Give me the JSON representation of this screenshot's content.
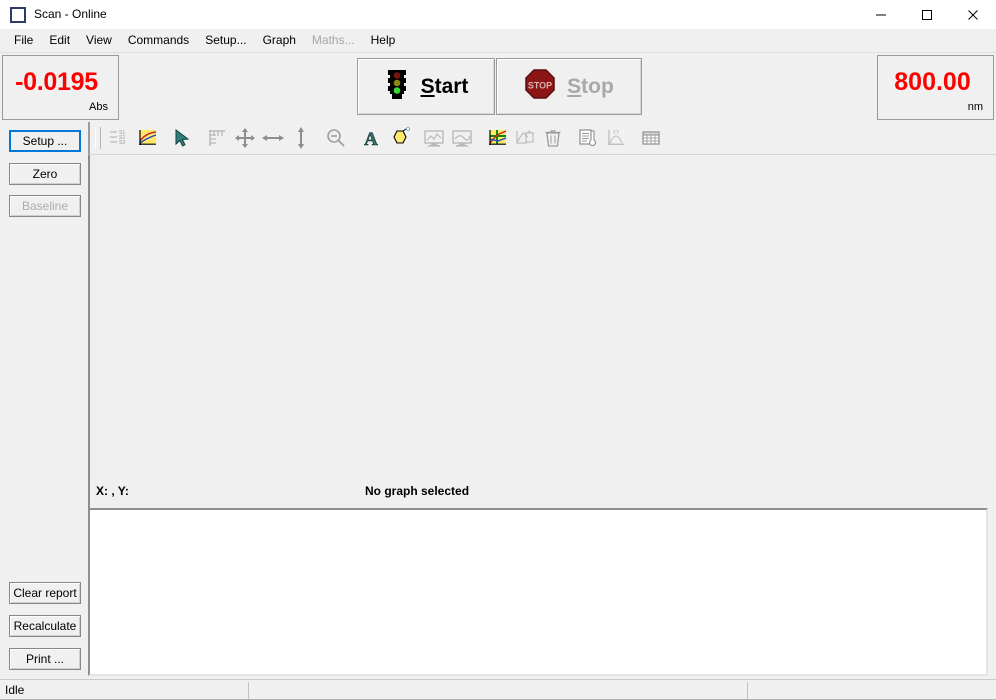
{
  "window": {
    "title": "Scan - Online",
    "icon": "app-window-icon",
    "controls": {
      "minimize": "minimize-icon",
      "maximize": "maximize-icon",
      "close": "close-icon"
    }
  },
  "menu": {
    "items": [
      {
        "label": "File",
        "enabled": true
      },
      {
        "label": "Edit",
        "enabled": true
      },
      {
        "label": "View",
        "enabled": true
      },
      {
        "label": "Commands",
        "enabled": true
      },
      {
        "label": "Setup...",
        "enabled": true
      },
      {
        "label": "Graph",
        "enabled": true
      },
      {
        "label": "Maths...",
        "enabled": false
      },
      {
        "label": "Help",
        "enabled": true
      }
    ]
  },
  "readout": {
    "value": "-0.0195",
    "unit": "Abs",
    "color": "#ff0000"
  },
  "wavelength": {
    "value": "800.00",
    "unit": "nm",
    "color": "#ff0000"
  },
  "controls": {
    "start": {
      "label": "Start",
      "accel": "S",
      "icon": "traffic-light-icon",
      "enabled": true
    },
    "stop": {
      "label": "Stop",
      "accel": "S",
      "icon": "stop-sign-icon",
      "enabled": false
    }
  },
  "sidebar": {
    "buttons": [
      {
        "label": "Setup ...",
        "name": "setup",
        "enabled": true,
        "focused": true
      },
      {
        "label": "Zero",
        "name": "zero",
        "enabled": true,
        "focused": false
      },
      {
        "label": "Baseline",
        "name": "baseline",
        "enabled": false,
        "focused": false
      },
      {
        "label": "Clear report",
        "name": "clear-report",
        "enabled": true,
        "focused": false
      },
      {
        "label": "Recalculate",
        "name": "recalculate",
        "enabled": true,
        "focused": false
      },
      {
        "label": "Print ...",
        "name": "print",
        "enabled": true,
        "focused": false
      }
    ]
  },
  "toolbar": {
    "items": [
      {
        "icon": "trace-list-icon",
        "enabled": true
      },
      {
        "icon": "graph-thumbnail-icon",
        "enabled": true
      },
      {
        "icon": "cursor-arrow-icon",
        "enabled": true
      },
      {
        "icon": "ruler-icon",
        "enabled": false
      },
      {
        "icon": "zoom-box-icon",
        "enabled": false
      },
      {
        "icon": "zoom-horizontal-icon",
        "enabled": false
      },
      {
        "icon": "zoom-vertical-icon",
        "enabled": false
      },
      {
        "icon": "zoom-out-icon",
        "enabled": false
      },
      {
        "icon": "text-label-icon",
        "enabled": true
      },
      {
        "icon": "molecule-icon",
        "enabled": true
      },
      {
        "icon": "monitor-trace-icon",
        "enabled": false
      },
      {
        "icon": "monitor-trace-2-icon",
        "enabled": false
      },
      {
        "icon": "overlay-graph-icon",
        "enabled": true
      },
      {
        "icon": "delete-trace-icon",
        "enabled": false
      },
      {
        "icon": "trash-icon",
        "enabled": true
      },
      {
        "icon": "report-icon",
        "enabled": true
      },
      {
        "icon": "peaks-icon",
        "enabled": false
      },
      {
        "icon": "grid-table-icon",
        "enabled": true
      }
    ]
  },
  "graph": {
    "coordinates": "X: , Y:",
    "message": "No graph selected"
  },
  "report": {
    "content": ""
  },
  "statusbar": {
    "text": "Idle",
    "pane2": "",
    "pane3": ""
  }
}
